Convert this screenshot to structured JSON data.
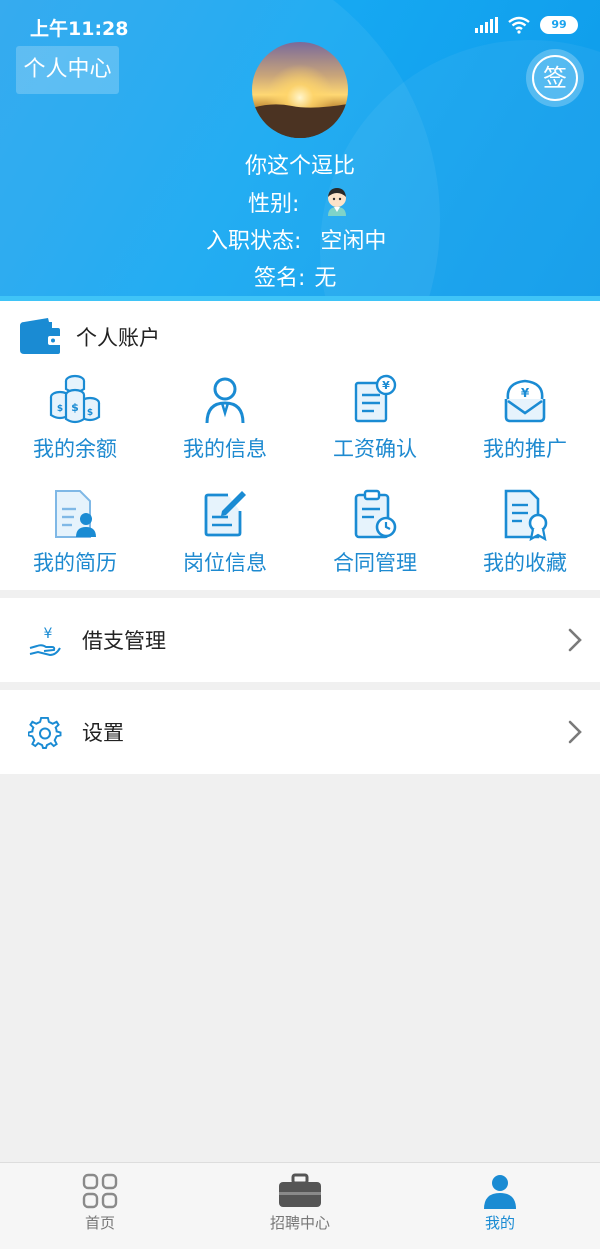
{
  "status_bar": {
    "time": "上午11:28",
    "battery": "99"
  },
  "header": {
    "page_title": "个人中心",
    "sign_label": "签",
    "user_name": "你这个逗比",
    "gender_label": "性别:",
    "employment_label": "入职状态:",
    "employment_value": "空闲中",
    "signature_label": "签名:",
    "signature_value": "无",
    "accent_color": "#16a8f2"
  },
  "account": {
    "title": "个人账户",
    "items": [
      {
        "label": "我的余额",
        "icon": "coins-icon"
      },
      {
        "label": "我的信息",
        "icon": "user-icon"
      },
      {
        "label": "工资确认",
        "icon": "salary-doc-icon"
      },
      {
        "label": "我的推广",
        "icon": "promotion-icon"
      },
      {
        "label": "我的简历",
        "icon": "resume-icon"
      },
      {
        "label": "岗位信息",
        "icon": "edit-doc-icon"
      },
      {
        "label": "合同管理",
        "icon": "contract-clock-icon"
      },
      {
        "label": "我的收藏",
        "icon": "certificate-icon"
      }
    ]
  },
  "list": [
    {
      "label": "借支管理",
      "icon": "loan-hand-icon"
    },
    {
      "label": "设置",
      "icon": "gear-icon"
    }
  ],
  "bottom_nav": [
    {
      "label": "首页",
      "icon": "grid-icon",
      "active": false
    },
    {
      "label": "招聘中心",
      "icon": "briefcase-icon",
      "active": false
    },
    {
      "label": "我的",
      "icon": "person-icon",
      "active": true
    }
  ]
}
